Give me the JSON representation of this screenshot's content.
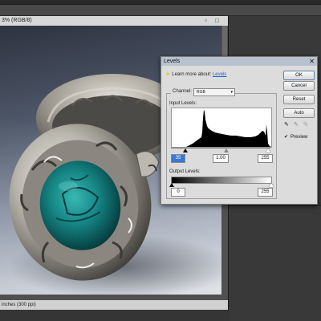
{
  "document": {
    "title": "3% (RGB/8)",
    "status": "inches (300 ppi)",
    "image_icon": "ring-photo"
  },
  "levels": {
    "title": "Levels",
    "close_icon": "close-icon",
    "learn_prefix": "Learn more about:",
    "learn_link": "Levels",
    "channel_label": "Channel:",
    "channel_value": "RGB",
    "input_label": "Input Levels:",
    "input_black": "35",
    "input_gamma": "1.00",
    "input_white": "255",
    "output_label": "Output Levels:",
    "output_black": "0",
    "output_white": "255",
    "buttons": {
      "ok": "OK",
      "cancel": "Cancel",
      "reset": "Reset",
      "auto": "Auto"
    },
    "preview_label": "Preview",
    "preview_checked": true
  },
  "colors": {
    "dialog_title": "#b8c2cf",
    "selected_field": "#3a78d6",
    "link": "#1a5fd0"
  }
}
